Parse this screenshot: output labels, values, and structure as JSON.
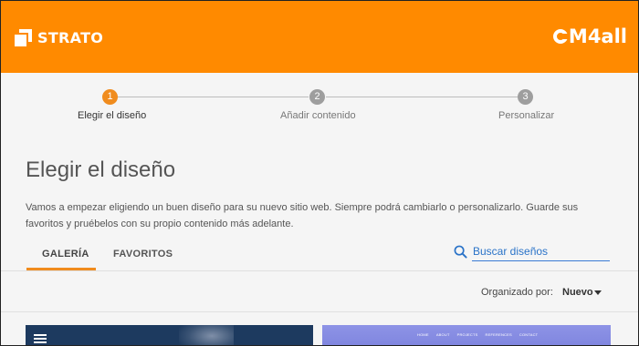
{
  "header": {
    "brand": "STRATO",
    "partner_logo": "M4all"
  },
  "stepper": {
    "steps": [
      {
        "number": "1",
        "label": "Elegir el diseño",
        "state": "active"
      },
      {
        "number": "2",
        "label": "Añadir contenido",
        "state": "inactive"
      },
      {
        "number": "3",
        "label": "Personalizar",
        "state": "inactive"
      }
    ]
  },
  "main": {
    "title": "Elegir el diseño",
    "description": "Vamos a empezar eligiendo un buen diseño para su nuevo sitio web. Siempre podrá cambiarlo o personalizarlo. Guarde sus favoritos y pruébelos con su propio contenido más adelante."
  },
  "tabs": [
    {
      "label": "GALERÍA",
      "active": true
    },
    {
      "label": "FAVORITOS",
      "active": false
    }
  ],
  "search": {
    "label": "Buscar diseños"
  },
  "sort": {
    "label": "Organizado por:",
    "value": "Nuevo"
  },
  "cards": [
    {
      "icon": "menu-icon"
    },
    {
      "nav_items": [
        "HOME",
        "ABOUT",
        "PROJECTS",
        "REFERENCES",
        "CONTACT"
      ]
    }
  ],
  "colors": {
    "brand_orange": "#ff8a00",
    "step_active": "#f08c1e",
    "step_inactive": "#9e9e9e",
    "link_blue": "#2a73c8"
  }
}
